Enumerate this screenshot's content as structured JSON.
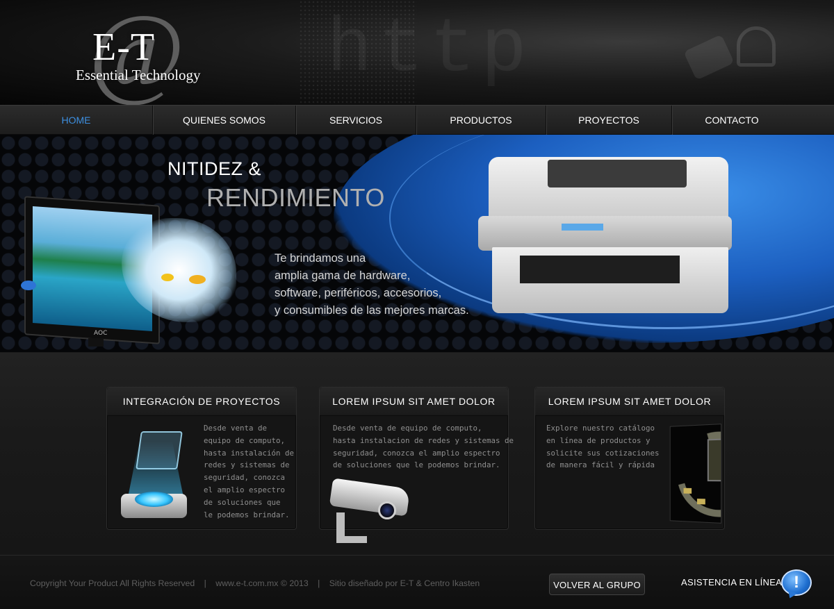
{
  "brand": {
    "mark": "E-T",
    "symbol": "@",
    "name": "Essential Technology"
  },
  "nav": {
    "items": [
      {
        "label": "HOME",
        "active": true
      },
      {
        "label": "QUIENES SOMOS"
      },
      {
        "label": "SERVICIOS"
      },
      {
        "label": "PRODUCTOS"
      },
      {
        "label": "PROYECTOS"
      },
      {
        "label": "CONTACTO"
      }
    ]
  },
  "hero": {
    "title_line1": "NITIDEZ &",
    "title_line2": "RENDIMIENTO",
    "monitor_brand": "AOC",
    "text_lines": [
      "Te brindamos una",
      "amplia gama de hardware,",
      "software, periféricos, accesorios,",
      "y consumibles de las mejores marcas."
    ]
  },
  "cards": [
    {
      "title": "INTEGRACIÓN DE PROYECTOS",
      "image": "hologram-folder-icon",
      "text_lines": [
        "Desde venta de",
        "equipo de computo,",
        "hasta instalación de",
        "redes y sistemas de",
        "seguridad, conozca",
        "el amplio espectro",
        "de soluciones que",
        "le podemos brindar."
      ]
    },
    {
      "title": "LOREM IPSUM SIT AMET DOLOR",
      "image": "security-camera-icon",
      "text_lines": [
        "Desde venta de equipo de computo,",
        "hasta instalacion de redes y sistemas de",
        "seguridad, conozca el amplio espectro",
        "de soluciones que le podemos brindar."
      ]
    },
    {
      "title": "LOREM IPSUM SIT AMET DOLOR",
      "image": "server-hardware-image",
      "text_lines": [
        "Explore nuestro catálogo",
        "en línea de productos y",
        "solicite sus cotizaciones",
        "de manera fácil y rápida"
      ]
    }
  ],
  "footer": {
    "copyright": "Copyright Your Product All Rights Reserved",
    "site": "www.e-t.com.mx © 2013",
    "credits": "Sitio diseñado por E-T & Centro Ikasten",
    "separator": "|",
    "back_button": "VOLVER AL GRUPO",
    "assist_label": "ASISTENCIA EN LÍNEA",
    "assist_icon_glyph": "!"
  },
  "colors": {
    "accent": "#3d8fe0",
    "background": "#1b1b1b",
    "hero_blue": "#1c5fc0"
  }
}
